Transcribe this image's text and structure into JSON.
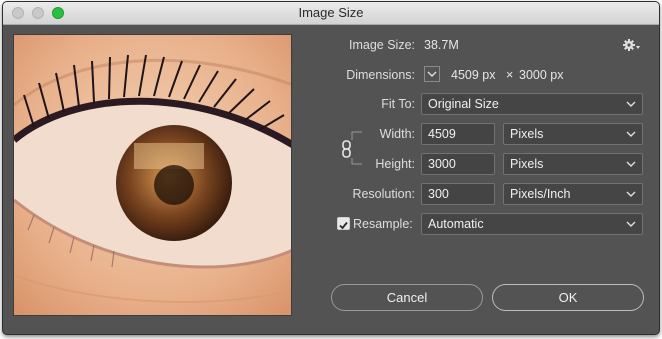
{
  "window": {
    "title": "Image Size"
  },
  "image_size": {
    "label": "Image Size:",
    "value": "38.7M"
  },
  "dimensions": {
    "label": "Dimensions:",
    "width": "4509 px",
    "times": "×",
    "height": "3000 px"
  },
  "fit_to": {
    "label": "Fit To:",
    "value": "Original Size"
  },
  "width": {
    "label": "Width:",
    "value": "4509",
    "unit": "Pixels"
  },
  "height": {
    "label": "Height:",
    "value": "3000",
    "unit": "Pixels"
  },
  "resolution": {
    "label": "Resolution:",
    "value": "300",
    "unit": "Pixels/Inch"
  },
  "resample": {
    "label": "Resample:",
    "checked": true,
    "value": "Automatic"
  },
  "buttons": {
    "cancel": "Cancel",
    "ok": "OK"
  },
  "icons": {
    "gear": "gear-icon",
    "chain": "chain-link-icon",
    "chevron": "chevron-down-icon",
    "dimensions_toggle": "chevron-down-icon"
  },
  "colors": {
    "dialog_bg": "#535353",
    "traffic_zoom": "#29c13f",
    "field_border": "#727272"
  }
}
